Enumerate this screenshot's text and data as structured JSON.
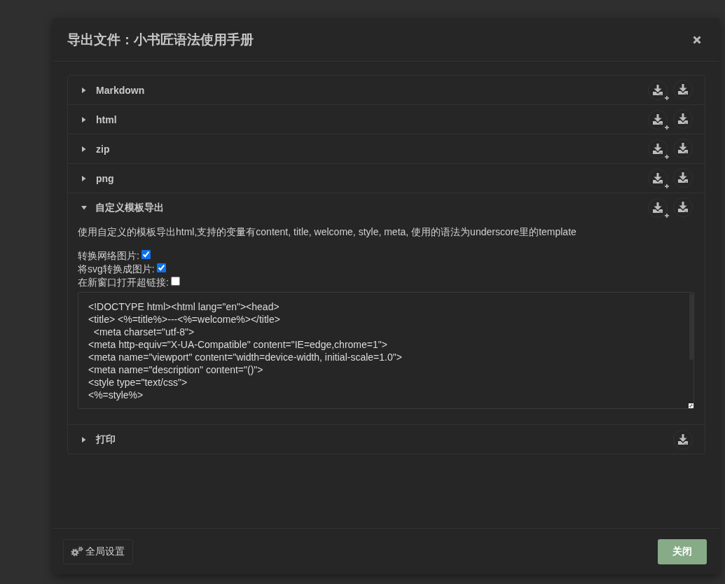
{
  "dialog": {
    "title": "导出文件：小书匠语法使用手册"
  },
  "panels": [
    {
      "label": "Markdown",
      "expanded": false,
      "actions": [
        {
          "kind": "download_plus"
        },
        {
          "kind": "download"
        }
      ]
    },
    {
      "label": "html",
      "expanded": false,
      "actions": [
        {
          "kind": "download_plus"
        },
        {
          "kind": "download"
        }
      ]
    },
    {
      "label": "zip",
      "expanded": false,
      "actions": [
        {
          "kind": "download_plus"
        },
        {
          "kind": "download"
        }
      ]
    },
    {
      "label": "png",
      "expanded": false,
      "actions": [
        {
          "kind": "download_plus"
        },
        {
          "kind": "download"
        }
      ]
    },
    {
      "label": "自定义模板导出",
      "expanded": true,
      "actions": [
        {
          "kind": "download_plus"
        },
        {
          "kind": "download"
        }
      ],
      "description": "使用自定义的模板导出html,支持的变量有content, title, welcome, style, meta, 使用的语法为underscore里的template",
      "options": [
        {
          "label": "转换网络图片:",
          "checked": true
        },
        {
          "label": "将svg转换成图片:",
          "checked": true
        },
        {
          "label": "在新窗口打开超链接:",
          "checked": false
        }
      ],
      "template": {
        "value": "<!DOCTYPE html><html lang=\"en\"><head>\n<title> <%=title%>---<%=welcome%></title>\n  <meta charset=\"utf-8\">\n<meta http-equiv=\"X-UA-Compatible\" content=\"IE=edge,chrome=1\">\n<meta name=\"viewport\" content=\"width=device-width, initial-scale=1.0\">\n<meta name=\"description\" content=\"()\">\n<style type=\"text/css\">\n<%=style%>"
      }
    },
    {
      "label": "打印",
      "expanded": false,
      "actions": [
        {
          "kind": "download"
        }
      ]
    }
  ],
  "footer": {
    "settings_button": "全局设置",
    "close_button": "关闭"
  }
}
